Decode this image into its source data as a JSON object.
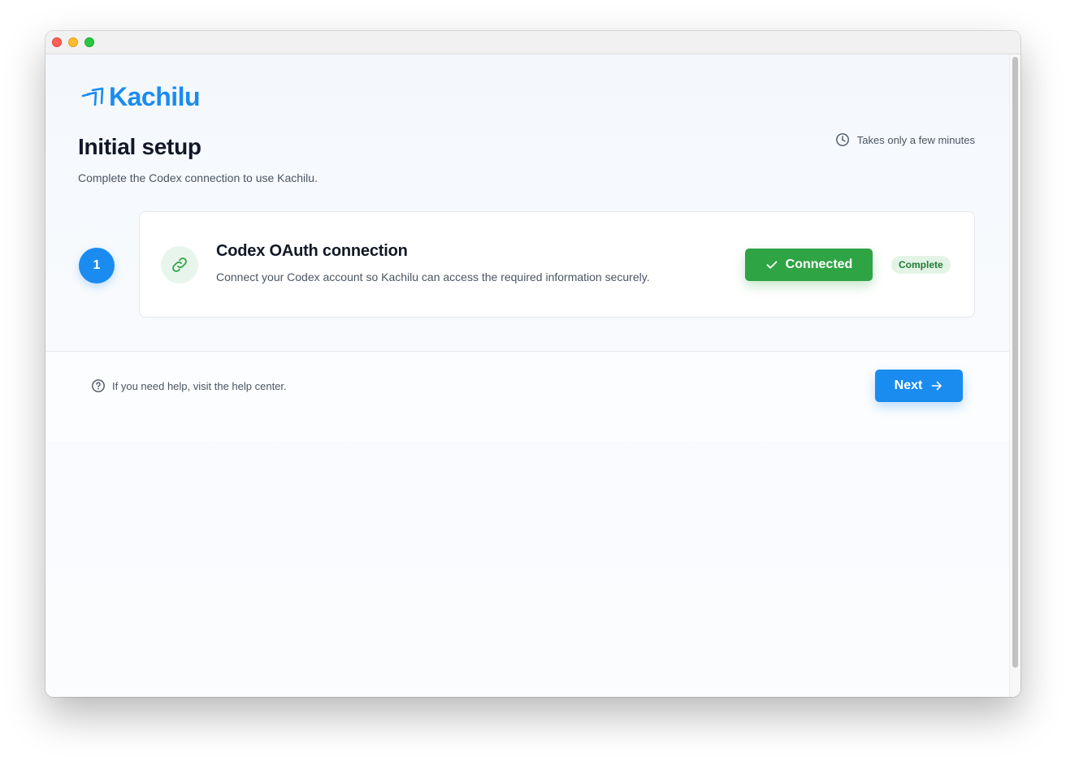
{
  "app": {
    "name": "Kachilu",
    "brand_color": "#1a8cf0"
  },
  "header": {
    "title": "Initial setup",
    "subtitle": "Complete the Codex connection to use Kachilu.",
    "time_note": "Takes only a few minutes",
    "time_icon": "clock-icon"
  },
  "steps": [
    {
      "number": "1",
      "icon": "link-icon",
      "title": "Codex OAuth connection",
      "description": "Connect your Codex account so Kachilu can access the required information securely.",
      "button_label": "Connected",
      "button_icon": "check-icon",
      "status": "Complete",
      "status_color": "#2fa445"
    }
  ],
  "footer": {
    "help_icon": "question-circle-icon",
    "help_text": "If you need help, visit the help center.",
    "next_label": "Next",
    "next_icon": "arrow-right-icon"
  }
}
